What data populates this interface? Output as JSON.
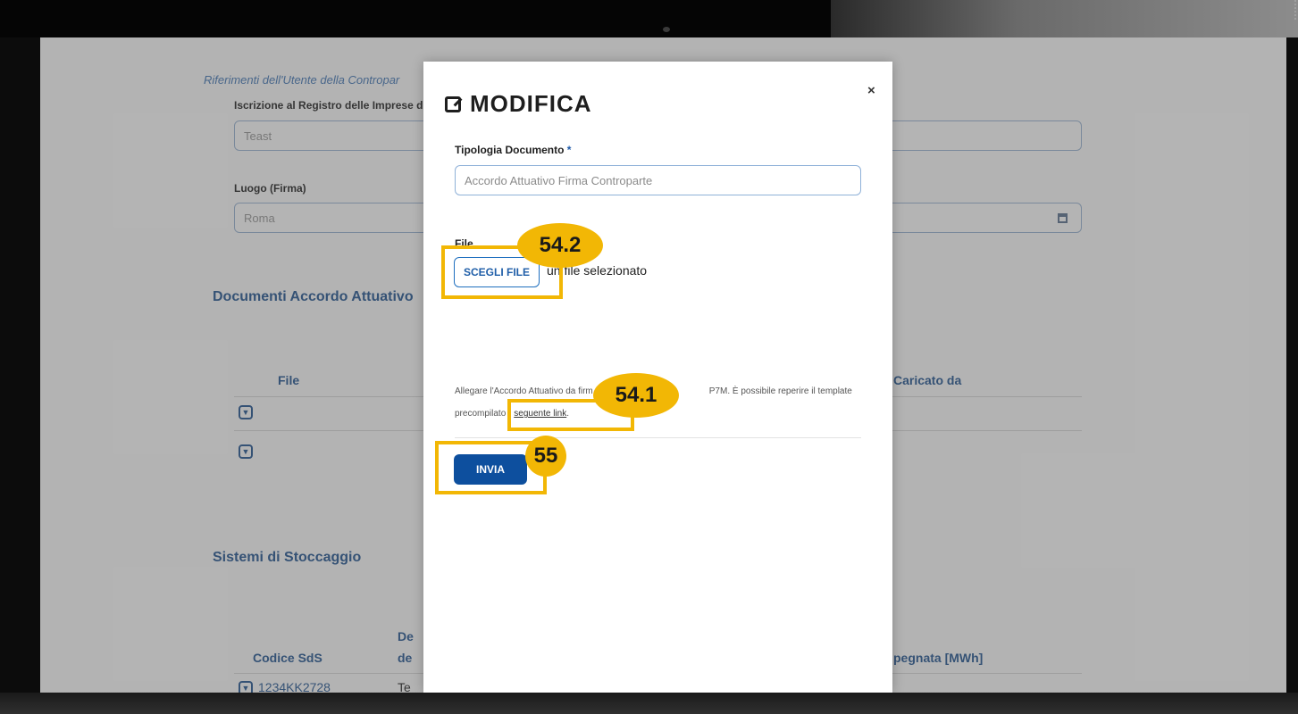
{
  "background": {
    "section_subtitle": "Riferimenti dell'Utente della Contropar",
    "registro_label": "Iscrizione al Registro delle Imprese di",
    "registro_value": "Teast",
    "luogo_label": "Luogo (Firma)",
    "luogo_value": "Roma",
    "documenti_title": "Documenti Accordo Attuativo",
    "documenti_col_file": "File",
    "documenti_col_caricato": "Caricato da",
    "sistemi_title": "Sistemi di Stoccaggio",
    "sistemi_col_codice": "Codice SdS",
    "sistemi_col_de_line1": "De",
    "sistemi_col_de_line2": "de",
    "sistemi_col_energia": "pegnata [MWh]",
    "sistemi_row_codice": "1234KK2728",
    "sistemi_row_de": "Te"
  },
  "modal": {
    "title": "MODIFICA",
    "close_glyph": "×",
    "tipologia_label": "Tipologia Documento",
    "required_mark": "*",
    "tipologia_value": "Accordo Attuativo Firma Controparte",
    "file_label": "File",
    "choose_file_button": "SCEGLI FILE",
    "no_file_text": "un file selezionato",
    "note_line1_a": "Allegare l'Accordo Attuativo da firm",
    "note_line1_b": "P7M. È possibile reperire il template",
    "note_line2_a": "precompilato",
    "note_line2_b": "l",
    "note_link": "seguente link",
    "note_end": ".",
    "send_button": "INVIA"
  },
  "callouts": {
    "choose_file": "54.2",
    "link": "54.1",
    "send": "55"
  },
  "colors": {
    "callout": "#f2b705",
    "primary": "#0d4f9e",
    "heading": "#1f4e86"
  }
}
